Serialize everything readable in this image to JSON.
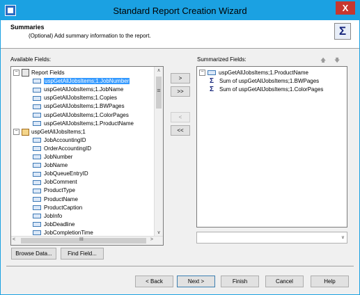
{
  "window": {
    "title": "Standard Report Creation Wizard",
    "close_glyph": "X"
  },
  "header": {
    "title": "Summaries",
    "subtitle": "(Optional) Add summary information to the report.",
    "icon": "sigma-icon",
    "icon_glyph": "Σ"
  },
  "available": {
    "label": "Available Fields:",
    "root": "Report Fields",
    "report_fields": [
      "uspGetAllJobsItems;1.JobNumber",
      "uspGetAllJobsItems;1.JobName",
      "uspGetAllJobsItems;1.Copies",
      "uspGetAllJobsItems;1.BWPages",
      "uspGetAllJobsItems;1.ColorPages",
      "uspGetAllJobsItems;1.ProductName"
    ],
    "table": "uspGetAllJobsItems;1",
    "table_fields": [
      "JobAccountingID",
      "OrderAccountingID",
      "JobNumber",
      "JobName",
      "JobQueueEntryID",
      "JobComment",
      "ProductType",
      "ProductName",
      "ProductCaption",
      "JobInfo",
      "JobDeadline",
      "JobCompletionTime"
    ],
    "selected_index": 0
  },
  "summarized": {
    "label": "Summarized Fields:",
    "group": "uspGetAllJobsItems;1.ProductName",
    "items": [
      "Sum of uspGetAllJobsItems;1.BWPages",
      "Sum of uspGetAllJobsItems;1.ColorPages"
    ]
  },
  "transfer": {
    "add": ">",
    "add_all": ">>",
    "remove": "<",
    "remove_all": "<<"
  },
  "buttons": {
    "browse": "Browse Data...",
    "find": "Find Field...",
    "back": "< Back",
    "next": "Next >",
    "finish": "Finish",
    "cancel": "Cancel",
    "help": "Help"
  },
  "scroll_glyphs": {
    "up": "∧",
    "down": "∨",
    "left": "<",
    "right": ">",
    "grip": "≡",
    "hgrip": "III",
    "combo": "∨",
    "move_up": "🡅",
    "move_down": "🡇"
  }
}
